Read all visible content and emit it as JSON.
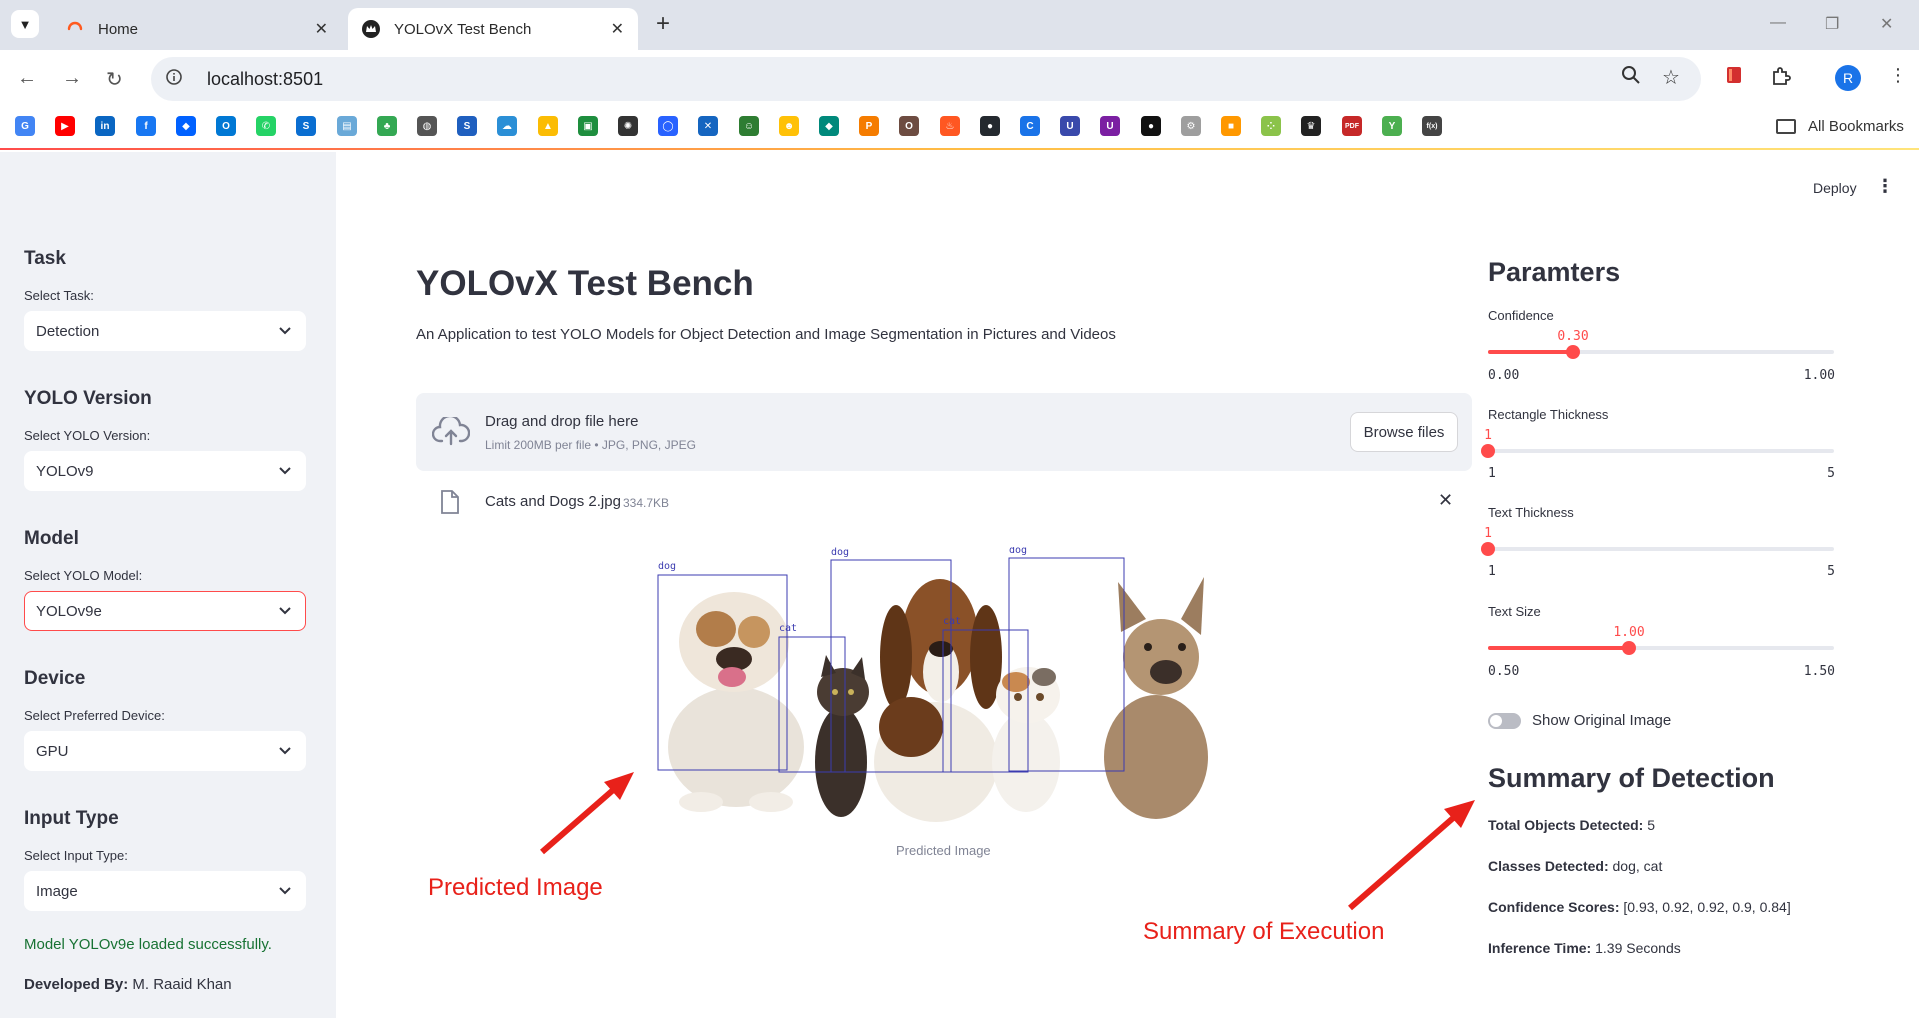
{
  "browser": {
    "tabs": [
      {
        "title": "Home",
        "active": false,
        "favicon": "streamlit-loading-icon"
      },
      {
        "title": "YOLOvX Test Bench",
        "active": true,
        "favicon": "crown-icon"
      }
    ],
    "url": "localhost:8501",
    "profile_initial": "R",
    "all_bookmarks_label": "All Bookmarks",
    "bookmarks": [
      {
        "name": "google-icon",
        "color": "#4285f4",
        "glyph": "G"
      },
      {
        "name": "youtube-icon",
        "color": "#ff0000",
        "glyph": "▶"
      },
      {
        "name": "linkedin-icon",
        "color": "#0a66c2",
        "glyph": "in"
      },
      {
        "name": "facebook-icon",
        "color": "#1877f2",
        "glyph": "f"
      },
      {
        "name": "dropbox-icon",
        "color": "#0061ff",
        "glyph": "◆"
      },
      {
        "name": "outlook-icon",
        "color": "#0078d4",
        "glyph": "O"
      },
      {
        "name": "whatsapp-icon",
        "color": "#25d366",
        "glyph": "✆"
      },
      {
        "name": "sap-icon",
        "color": "#0a6ed1",
        "glyph": "S"
      },
      {
        "name": "chart-icon",
        "color": "#6aa9d8",
        "glyph": "▤"
      },
      {
        "name": "tree-icon",
        "color": "#34a853",
        "glyph": "♣"
      },
      {
        "name": "globe-icon",
        "color": "#555555",
        "glyph": "◍"
      },
      {
        "name": "swirl-icon",
        "color": "#1f5fbf",
        "glyph": "S"
      },
      {
        "name": "cloud-icon",
        "color": "#2b8fd6",
        "glyph": "☁"
      },
      {
        "name": "google-drive-icon",
        "color": "#fbbc04",
        "glyph": "▲"
      },
      {
        "name": "google-classroom-icon",
        "color": "#1e8e3e",
        "glyph": "▣"
      },
      {
        "name": "openai-icon",
        "color": "#333333",
        "glyph": "✺"
      },
      {
        "name": "ring-icon",
        "color": "#2962ff",
        "glyph": "◯"
      },
      {
        "name": "puzzle-app-icon",
        "color": "#1565c0",
        "glyph": "✕"
      },
      {
        "name": "robot-icon",
        "color": "#2e7d32",
        "glyph": "☺"
      },
      {
        "name": "huggingface-icon",
        "color": "#ffc107",
        "glyph": "☻"
      },
      {
        "name": "diamond-icon",
        "color": "#00897b",
        "glyph": "◆"
      },
      {
        "name": "pma-icon",
        "color": "#f57c00",
        "glyph": "P"
      },
      {
        "name": "owl-icon",
        "color": "#6d4c41",
        "glyph": "O"
      },
      {
        "name": "flame-icon",
        "color": "#ff5722",
        "glyph": "♨"
      },
      {
        "name": "github-icon",
        "color": "#24292f",
        "glyph": "●"
      },
      {
        "name": "c-icon",
        "color": "#1a73e8",
        "glyph": "C"
      },
      {
        "name": "udacity-icon",
        "color": "#3949ab",
        "glyph": "U"
      },
      {
        "name": "shield-app-icon",
        "color": "#7b1fa2",
        "glyph": "U"
      },
      {
        "name": "leaf-icon",
        "color": "#111111",
        "glyph": "●"
      },
      {
        "name": "gear-icon",
        "color": "#9e9e9e",
        "glyph": "⚙"
      },
      {
        "name": "box-icon",
        "color": "#ff9800",
        "glyph": "■"
      },
      {
        "name": "dots-icon",
        "color": "#8bc34a",
        "glyph": "⁘"
      },
      {
        "name": "crown-icon",
        "color": "#222222",
        "glyph": "♛"
      },
      {
        "name": "pdf-icon",
        "color": "#c62828",
        "glyph": "PDF"
      },
      {
        "name": "yts-icon",
        "color": "#4caf50",
        "glyph": "Y"
      },
      {
        "name": "fx-icon",
        "color": "#444444",
        "glyph": "f(x)"
      }
    ]
  },
  "app": {
    "deploy_label": "Deploy",
    "sidebar": {
      "task": {
        "heading": "Task",
        "label": "Select Task:",
        "value": "Detection"
      },
      "yolo_version": {
        "heading": "YOLO Version",
        "label": "Select YOLO Version:",
        "value": "YOLOv9"
      },
      "model": {
        "heading": "Model",
        "label": "Select YOLO Model:",
        "value": "YOLOv9e"
      },
      "device": {
        "heading": "Device",
        "label": "Select Preferred Device:",
        "value": "GPU"
      },
      "input_type": {
        "heading": "Input Type",
        "label": "Select Input Type:",
        "value": "Image"
      },
      "success_message": "Model YOLOv9e loaded successfully.",
      "developed_by_label": "Developed By:",
      "developed_by_name": "M. Raaid Khan"
    },
    "main": {
      "title": "YOLOvX Test Bench",
      "subtitle": "An Application to test YOLO Models for Object Detection and Image Segmentation in Pictures and Videos",
      "uploader": {
        "drop_text": "Drag and drop file here",
        "limit_text": "Limit 200MB per file • JPG, PNG, JPEG",
        "browse_label": "Browse files"
      },
      "file": {
        "name": "Cats and Dogs 2.jpg",
        "size": "334.7KB"
      },
      "image_caption": "Predicted Image",
      "detections": [
        {
          "label": "dog"
        },
        {
          "label": "cat"
        },
        {
          "label": "dog"
        },
        {
          "label": "cat"
        },
        {
          "label": "dog"
        }
      ]
    },
    "params": {
      "title": "Paramters",
      "confidence": {
        "label": "Confidence",
        "value": "0.30",
        "min": "0.00",
        "max": "1.00",
        "fraction": 0.3
      },
      "rect_thickness": {
        "label": "Rectangle Thickness",
        "value": "1",
        "min": "1",
        "max": "5",
        "fraction": 0.0
      },
      "text_thickness": {
        "label": "Text Thickness",
        "value": "1",
        "min": "1",
        "max": "5",
        "fraction": 0.0
      },
      "text_size": {
        "label": "Text Size",
        "value": "1.00",
        "min": "0.50",
        "max": "1.50",
        "fraction": 0.5
      },
      "show_original_label": "Show Original Image",
      "show_original_on": false
    },
    "summary": {
      "title": "Summary of Detection",
      "total_label": "Total Objects Detected:",
      "total_value": "5",
      "classes_label": "Classes Detected:",
      "classes_value": "dog, cat",
      "scores_label": "Confidence Scores:",
      "scores_value": "[0.93, 0.92, 0.92, 0.9, 0.84]",
      "time_label": "Inference Time:",
      "time_value": "1.39 Seconds"
    }
  },
  "annotations": {
    "predicted_image": "Predicted Image",
    "summary_execution": "Summary of Execution",
    "color": "#e8211a"
  },
  "colors": {
    "accent": "#ff4b4b",
    "success": "#177233",
    "sidebar_bg": "#f0f2f6",
    "detection_box": "#3b3bb0"
  }
}
